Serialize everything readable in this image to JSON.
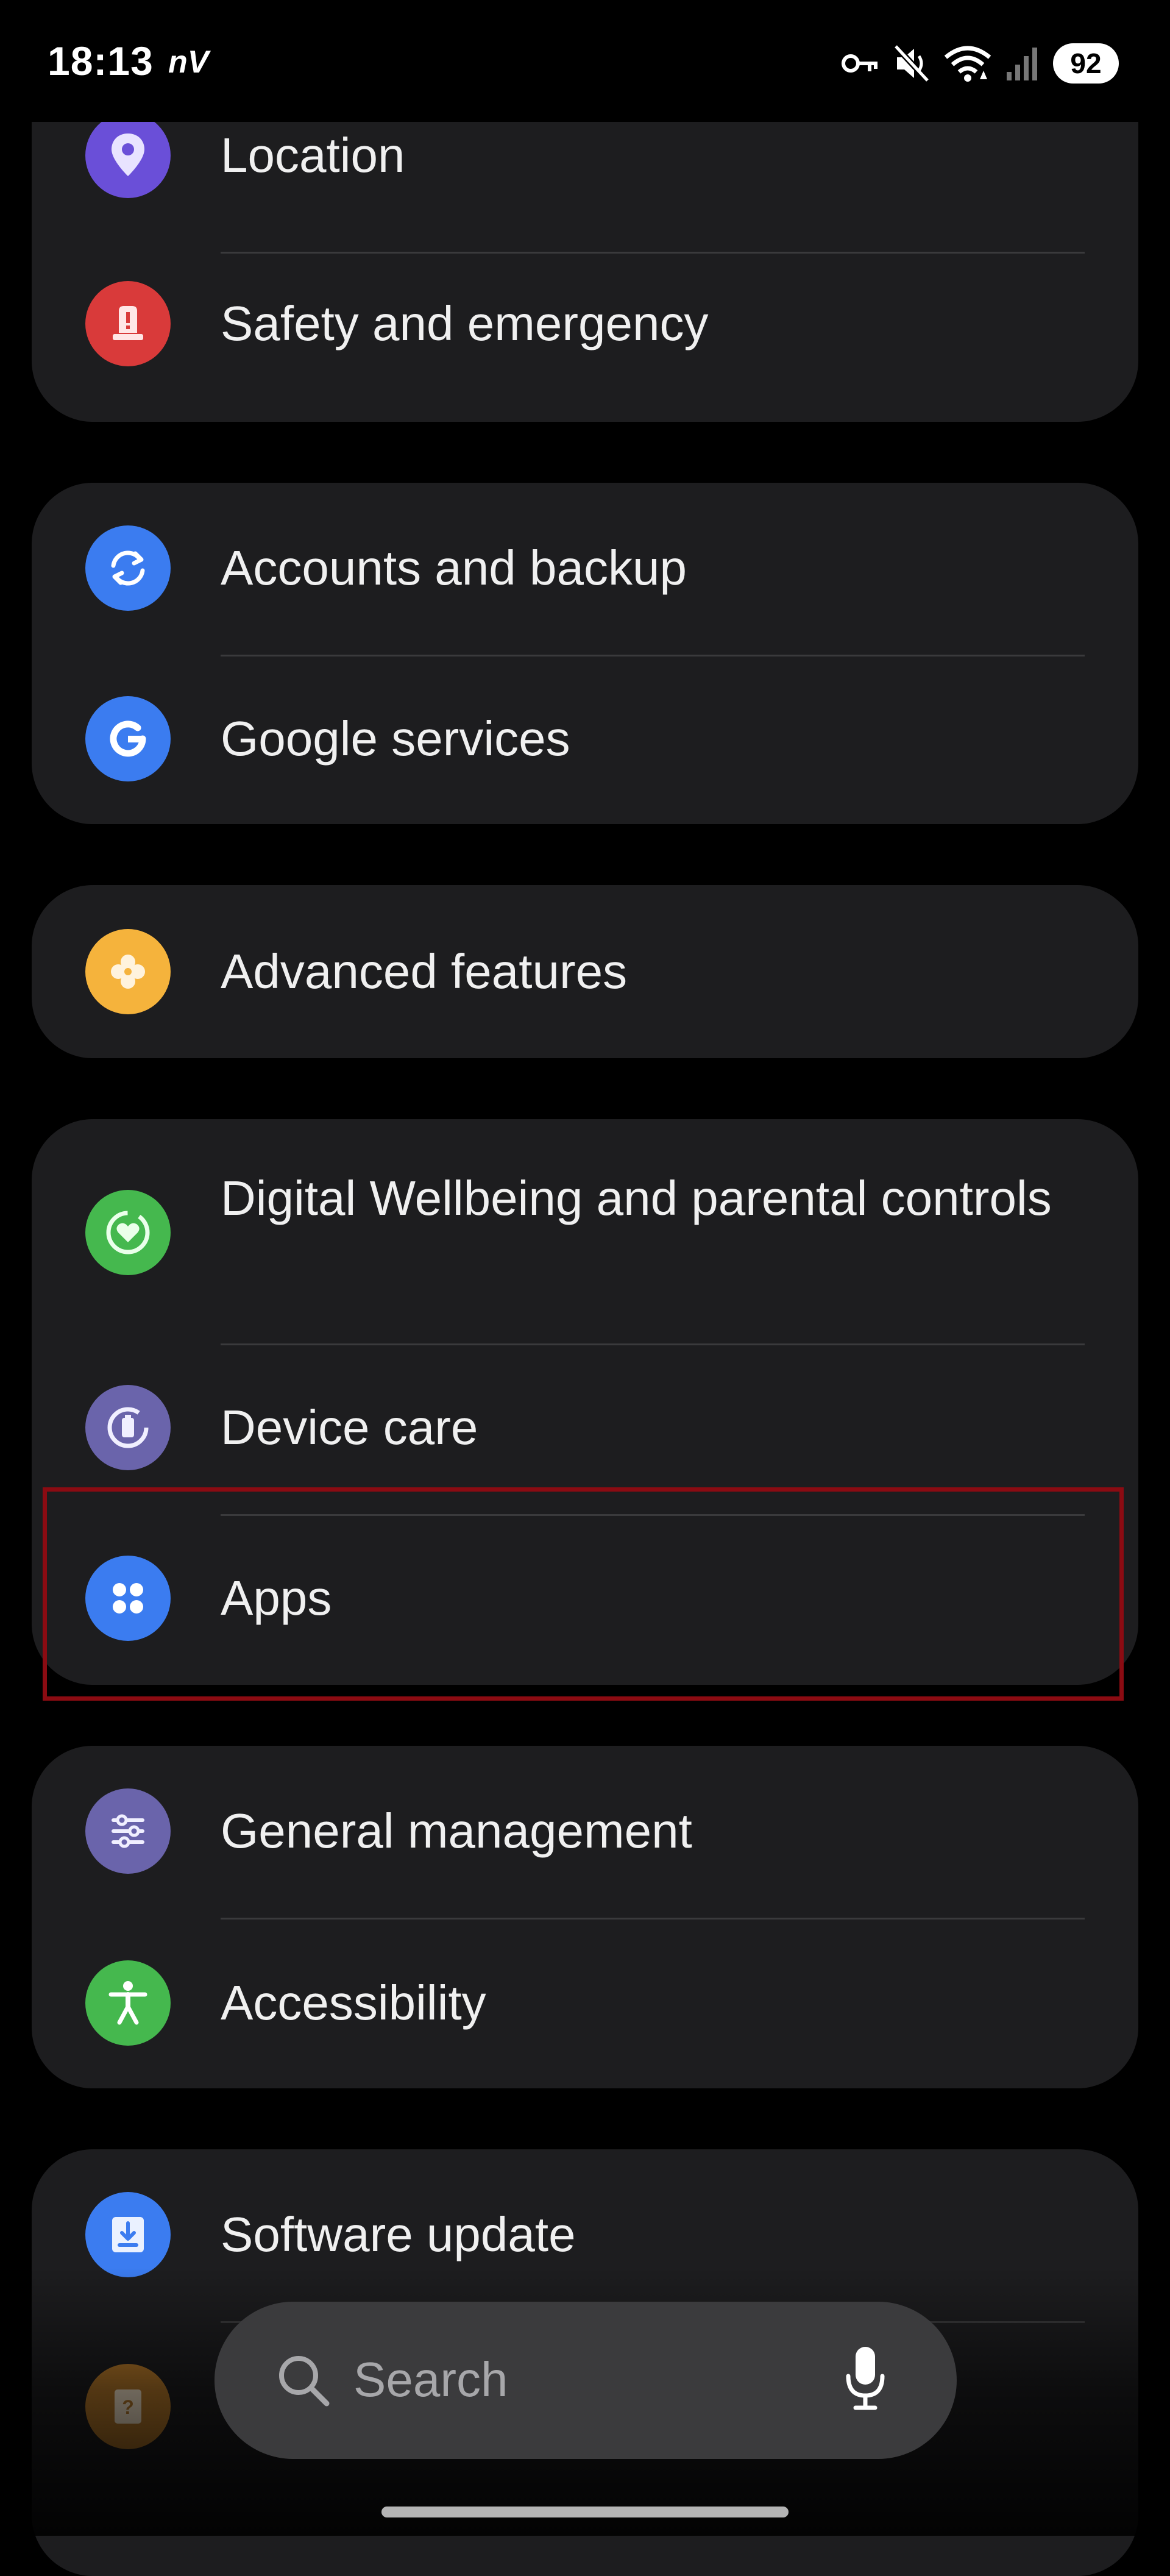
{
  "status_bar": {
    "time": "18:13",
    "carrier": "nV",
    "battery": "92",
    "icons": [
      "vpn-key-icon",
      "mute-icon",
      "wifi-icon",
      "signal-icon"
    ]
  },
  "settings": {
    "location": {
      "label": "Location",
      "icon": "location-pin-icon",
      "color": "#6a4fd8"
    },
    "safety": {
      "label": "Safety and emergency",
      "icon": "alert-beacon-icon",
      "color": "#d93a3a"
    },
    "accounts": {
      "label": "Accounts and backup",
      "icon": "sync-icon",
      "color": "#3b7cf0"
    },
    "google": {
      "label": "Google services",
      "icon": "google-g-icon",
      "color": "#3b7cf0"
    },
    "advanced": {
      "label": "Advanced features",
      "icon": "puzzle-gear-icon",
      "color": "#f5b33c"
    },
    "wellbeing": {
      "label": "Digital Wellbeing and parental controls",
      "icon": "heart-circle-icon",
      "color": "#45b84e"
    },
    "device_care": {
      "label": "Device care",
      "icon": "battery-circle-icon",
      "color": "#6a64ab"
    },
    "apps": {
      "label": "Apps",
      "icon": "four-dots-icon",
      "color": "#3b7cf0"
    },
    "general": {
      "label": "General management",
      "icon": "sliders-icon",
      "color": "#6a64ab"
    },
    "accessibility": {
      "label": "Accessibility",
      "icon": "accessibility-person-icon",
      "color": "#45b84e"
    },
    "software_update": {
      "label": "Software update",
      "icon": "download-tray-icon",
      "color": "#3b7cf0"
    },
    "tips": {
      "icon": "manual-book-icon",
      "color": "#b87a2a"
    }
  },
  "highlight": {
    "target": "Apps",
    "color": "#8b0b12"
  },
  "search": {
    "placeholder": "Search"
  }
}
